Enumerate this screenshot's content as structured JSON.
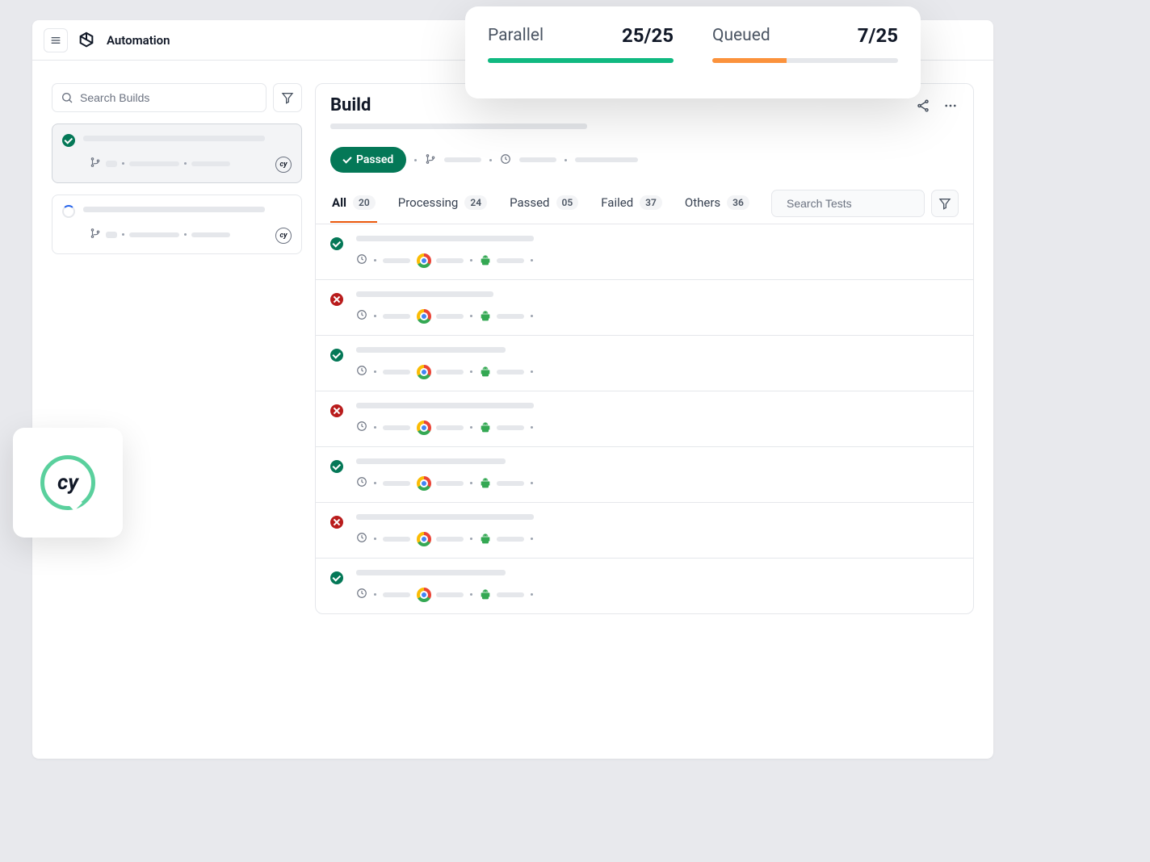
{
  "header": {
    "brand": "Automation"
  },
  "sidebar": {
    "search_placeholder": "Search Builds"
  },
  "build": {
    "title": "Build",
    "status_label": "Passed"
  },
  "tabs": [
    {
      "label": "All",
      "count": "20",
      "active": true
    },
    {
      "label": "Processing",
      "count": "24"
    },
    {
      "label": "Passed",
      "count": "05"
    },
    {
      "label": "Failed",
      "count": "37"
    },
    {
      "label": "Others",
      "count": "36"
    }
  ],
  "search_tests_placeholder": "Search Tests",
  "tests": [
    {
      "status": "pass",
      "title_width": 220
    },
    {
      "status": "fail",
      "title_width": 170
    },
    {
      "status": "pass",
      "title_width": 185
    },
    {
      "status": "fail",
      "title_width": 220
    },
    {
      "status": "pass",
      "title_width": 185
    },
    {
      "status": "fail",
      "title_width": 220
    },
    {
      "status": "pass",
      "title_width": 185
    }
  ],
  "metrics": {
    "parallel": {
      "label": "Parallel",
      "value": "25/25",
      "percent": 100
    },
    "queued": {
      "label": "Queued",
      "value": "7/25",
      "percent": 40
    }
  }
}
